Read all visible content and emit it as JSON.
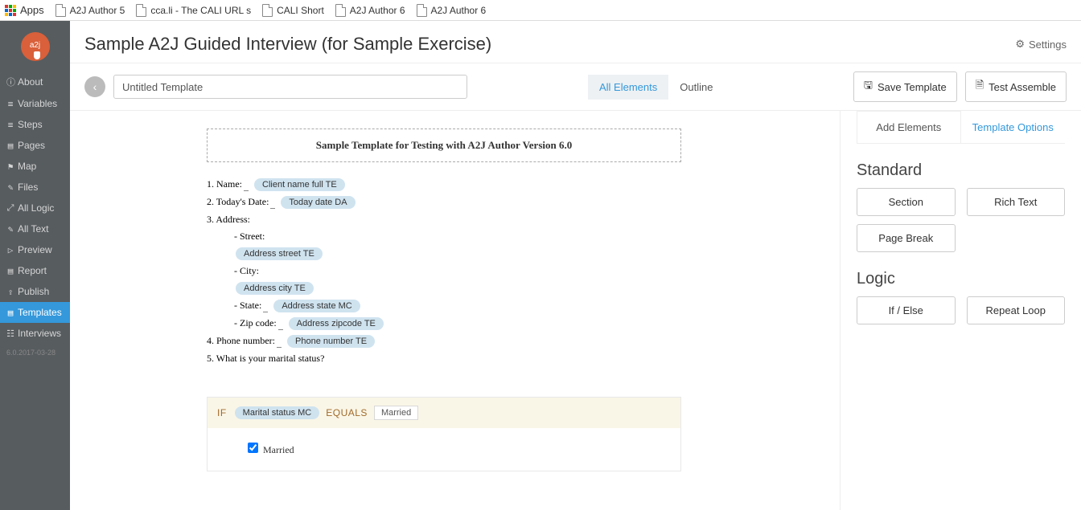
{
  "bookmarks": {
    "apps": "Apps",
    "items": [
      "A2J Author 5",
      "cca.li - The CALI URL s",
      "CALI Short",
      "A2J Author 6",
      "A2J Author 6"
    ]
  },
  "sidebar": {
    "logo": "a2j",
    "items": [
      {
        "label": "About",
        "icon": "ⓘ"
      },
      {
        "label": "Variables",
        "icon": "≡"
      },
      {
        "label": "Steps",
        "icon": "≡"
      },
      {
        "label": "Pages",
        "icon": "▤"
      },
      {
        "label": "Map",
        "icon": "⚑"
      },
      {
        "label": "Files",
        "icon": "✎"
      },
      {
        "label": "All Logic",
        "icon": "⤢"
      },
      {
        "label": "All Text",
        "icon": "✎"
      },
      {
        "label": "Preview",
        "icon": "▷"
      },
      {
        "label": "Report",
        "icon": "▤"
      },
      {
        "label": "Publish",
        "icon": "⇪"
      },
      {
        "label": "Templates",
        "icon": "▤",
        "active": true
      },
      {
        "label": "Interviews",
        "icon": "☷"
      }
    ],
    "version": "6.0.2017-03-28"
  },
  "header": {
    "title": "Sample A2J Guided Interview (for Sample Exercise)",
    "settings": "Settings"
  },
  "toolbar": {
    "template_name": "Untitled Template",
    "tabs": [
      "All Elements",
      "Outline"
    ],
    "save": "Save Template",
    "test": "Test Assemble"
  },
  "template": {
    "heading": "Sample Template for Testing with A2J Author Version 6.0",
    "lines": {
      "name_label": "1. Name:",
      "name_var": "Client name full TE",
      "today_label": "2. Today's Date:",
      "today_var": "Today date DA",
      "address_label": "3. Address:",
      "street_label": "- Street:",
      "street_var": "Address street TE",
      "city_label": "- City:",
      "city_var": "Address city TE",
      "state_label": "- State:",
      "state_var": "Address state MC",
      "zip_label": "- Zip code:",
      "zip_var": "Address zipcode TE",
      "phone_label": "4. Phone number:",
      "phone_var": "Phone number TE",
      "marital_label": "5. What is your marital status?"
    },
    "if_block": {
      "kw_if": "IF",
      "var": "Marital status MC",
      "kw_eq": "EQUALS",
      "value": "Married",
      "body": "Married"
    }
  },
  "panel": {
    "tabs": [
      "Add Elements",
      "Template Options"
    ],
    "standard": "Standard",
    "standard_buttons": [
      "Section",
      "Rich Text",
      "Page Break"
    ],
    "logic": "Logic",
    "logic_buttons": [
      "If / Else",
      "Repeat Loop"
    ]
  }
}
